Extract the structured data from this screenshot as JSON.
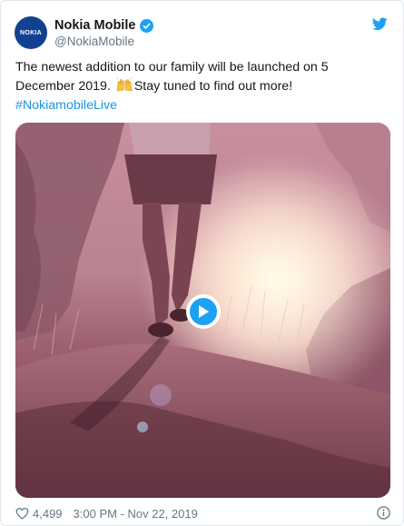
{
  "author": {
    "display_name": "Nokia Mobile",
    "handle": "@NokiaMobile",
    "avatar_text": "NOKIA",
    "avatar_color": "#124191",
    "verified": true
  },
  "tweet": {
    "text_part1": "The newest addition to our family will be launched on 5 December 2019.",
    "text_part2": "Stay tuned to find out more!",
    "hashtag": "#NokiamobileLive",
    "emoji": "raising-hands-emoji"
  },
  "media": {
    "type": "video",
    "play_icon": "play-icon"
  },
  "footer": {
    "like_count": "4,499",
    "timestamp": "3:00 PM - Nov 22, 2019"
  },
  "colors": {
    "accent": "#1da1f2",
    "hashtag": "#1b95e0",
    "muted": "#657786",
    "text": "#14171a"
  }
}
